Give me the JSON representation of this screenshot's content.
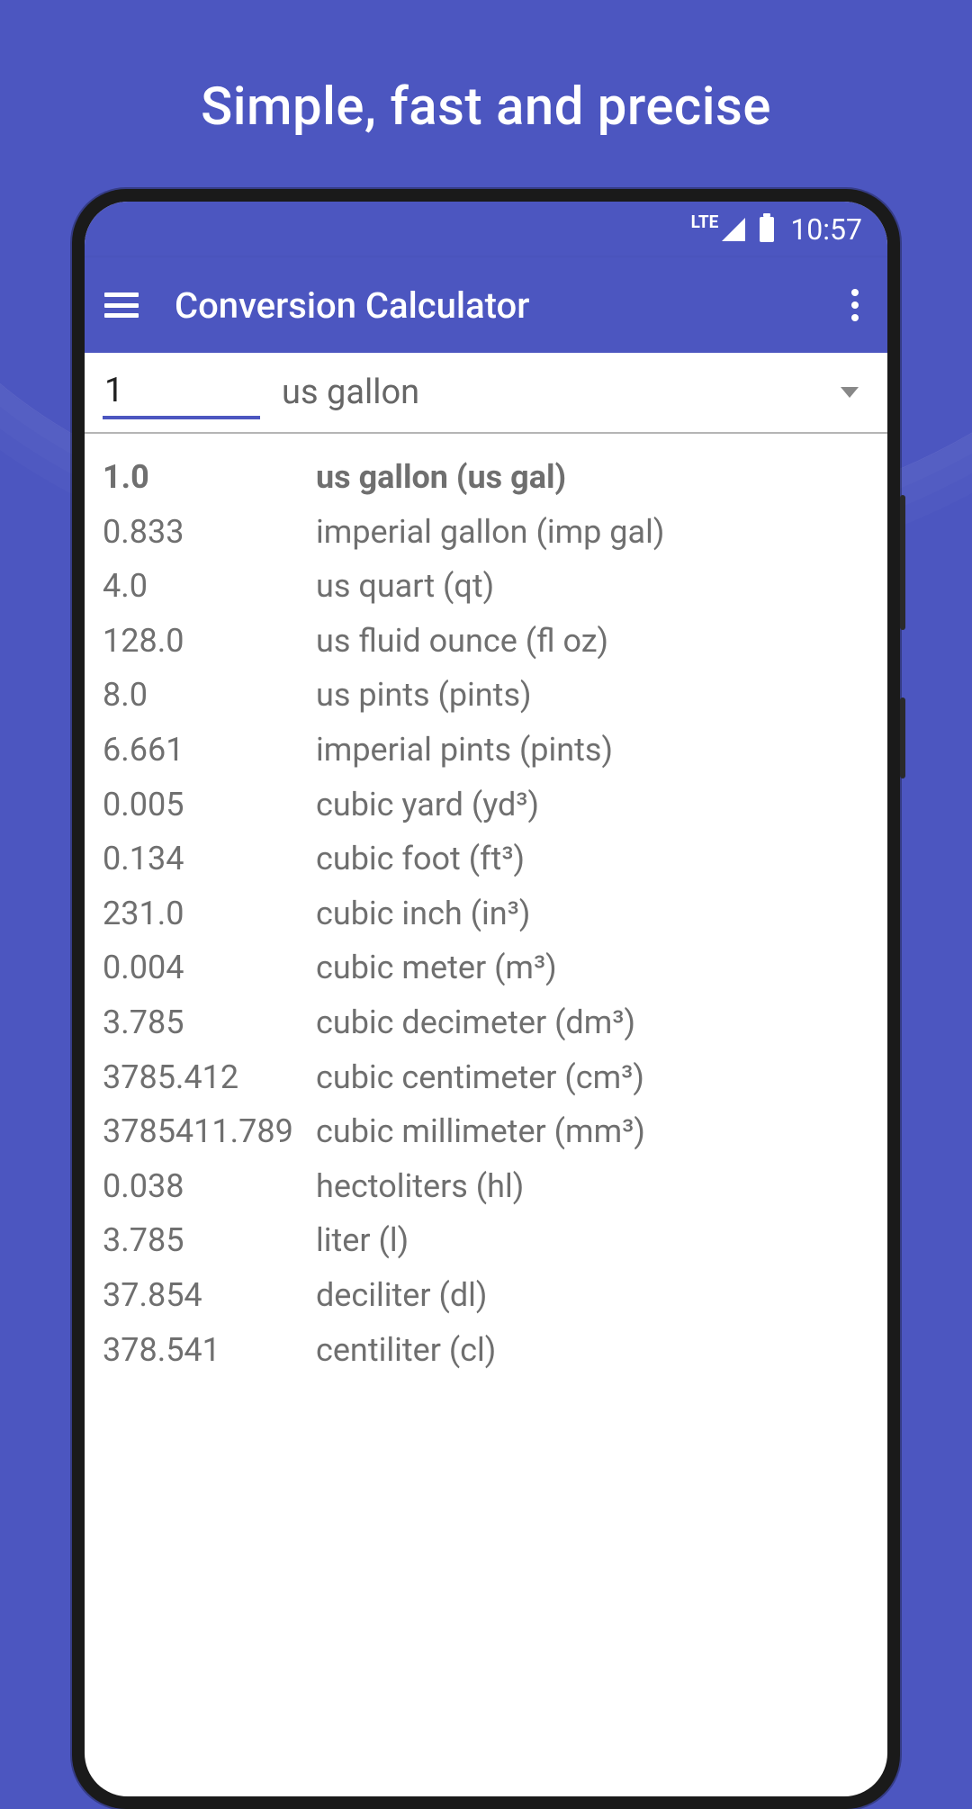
{
  "marketing": {
    "tagline": "Simple, fast and precise"
  },
  "status": {
    "network": "LTE",
    "time": "10:57"
  },
  "app": {
    "title": "Conversion Calculator"
  },
  "input": {
    "value": "1",
    "unit": "us gallon"
  },
  "results": [
    {
      "value": "1.0",
      "unit": "us gallon (us gal)",
      "highlighted": true
    },
    {
      "value": "0.833",
      "unit": "imperial gallon (imp gal)",
      "highlighted": false
    },
    {
      "value": "4.0",
      "unit": "us quart (qt)",
      "highlighted": false
    },
    {
      "value": "128.0",
      "unit": "us fluid ounce (fl oz)",
      "highlighted": false
    },
    {
      "value": "8.0",
      "unit": "us pints (pints)",
      "highlighted": false
    },
    {
      "value": "6.661",
      "unit": "imperial pints (pints)",
      "highlighted": false
    },
    {
      "value": "0.005",
      "unit": "cubic yard (yd³)",
      "highlighted": false
    },
    {
      "value": "0.134",
      "unit": "cubic foot (ft³)",
      "highlighted": false
    },
    {
      "value": "231.0",
      "unit": "cubic inch (in³)",
      "highlighted": false
    },
    {
      "value": "0.004",
      "unit": "cubic meter (m³)",
      "highlighted": false
    },
    {
      "value": "3.785",
      "unit": "cubic decimeter (dm³)",
      "highlighted": false
    },
    {
      "value": "3785.412",
      "unit": "cubic centimeter (cm³)",
      "highlighted": false
    },
    {
      "value": "3785411.789",
      "unit": "cubic millimeter (mm³)",
      "highlighted": false
    },
    {
      "value": "0.038",
      "unit": "hectoliters (hl)",
      "highlighted": false
    },
    {
      "value": "3.785",
      "unit": "liter (l)",
      "highlighted": false
    },
    {
      "value": "37.854",
      "unit": "deciliter (dl)",
      "highlighted": false
    },
    {
      "value": "378.541",
      "unit": "centiliter (cl)",
      "highlighted": false
    }
  ]
}
